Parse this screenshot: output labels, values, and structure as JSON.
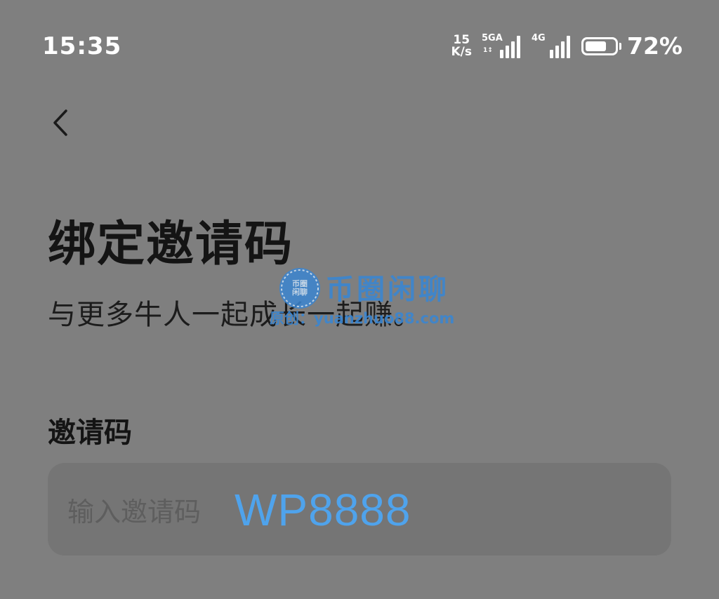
{
  "status_bar": {
    "time": "15:35",
    "net_speed_value": "15",
    "net_speed_unit": "K/s",
    "sim1_label": "5GA",
    "sim1_sub": "1↕",
    "sim2_label": "4G",
    "battery_percent": "72%",
    "battery_level": 0.72,
    "icons": [
      "network-speed-icon",
      "signal-5ga-icon",
      "signal-4g-icon",
      "battery-icon"
    ]
  },
  "nav": {
    "back_icon": "chevron-left-icon"
  },
  "page": {
    "title": "绑定邀请码",
    "subtitle": "与更多牛人一起成长一起赚。"
  },
  "watermark": {
    "logo_text": "币圈\n闲聊",
    "title": "币圈闲聊",
    "url": "原创：yuanzhuo88.com"
  },
  "form": {
    "label": "邀请码",
    "placeholder": "输入邀请码",
    "overlay_code": "WP8888"
  },
  "colors": {
    "background": "#7f7f7f",
    "input_background": "#757575",
    "accent": "#4fa3ec",
    "watermark": "#3b86d1"
  }
}
